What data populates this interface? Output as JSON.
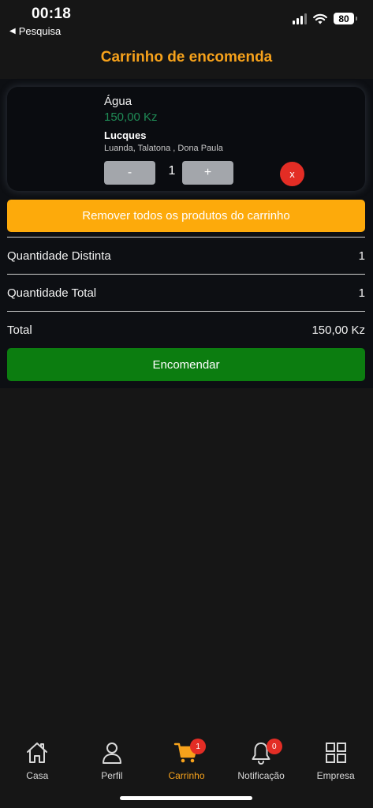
{
  "status_bar": {
    "time": "00:18",
    "back_label": "Pesquisa",
    "battery": "80"
  },
  "header": {
    "title": "Carrinho de encomenda"
  },
  "cart_item": {
    "name": "Água",
    "price": "150,00 Kz",
    "store": "Lucques",
    "location": "Luanda, Talatona , Dona Paula",
    "decrement_label": "-",
    "quantity": "1",
    "increment_label": "+",
    "remove_label": "x"
  },
  "actions": {
    "remove_all_label": "Remover todos os produtos do carrinho",
    "order_label": "Encomendar"
  },
  "summary": {
    "distinct_label": "Quantidade Distinta",
    "distinct_value": "1",
    "total_qty_label": "Quantidade Total",
    "total_qty_value": "1",
    "total_label": "Total",
    "total_value": "150,00 Kz"
  },
  "tabs": [
    {
      "label": "Casa",
      "icon": "home-icon"
    },
    {
      "label": "Perfil",
      "icon": "user-icon"
    },
    {
      "label": "Carrinho",
      "icon": "cart-icon",
      "badge": "1",
      "active": true
    },
    {
      "label": "Notificação",
      "icon": "bell-icon",
      "badge": "0"
    },
    {
      "label": "Empresa",
      "icon": "grid-icon"
    }
  ],
  "colors": {
    "accent": "#f7a21b",
    "price": "#1f8a55",
    "remove_all": "#fdaa0b",
    "order": "#0c7d10",
    "badge": "#e32d25"
  }
}
